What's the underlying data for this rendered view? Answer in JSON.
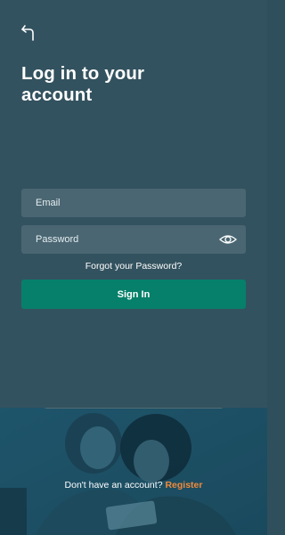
{
  "header": {
    "back_icon": "back-arrow-icon",
    "title_line1": "Log in to your",
    "title_line2": "account"
  },
  "form": {
    "email_placeholder": "Email",
    "password_placeholder": "Password",
    "password_toggle_icon": "eye-icon",
    "forgot_label": "Forgot your Password?",
    "signin_label": "Sign In"
  },
  "footer": {
    "prompt": "Don't have an account?",
    "register_label": "Register"
  },
  "colors": {
    "background": "#33525f",
    "field": "#4a6672",
    "primary": "#06806a",
    "link": "#f08a3c"
  }
}
